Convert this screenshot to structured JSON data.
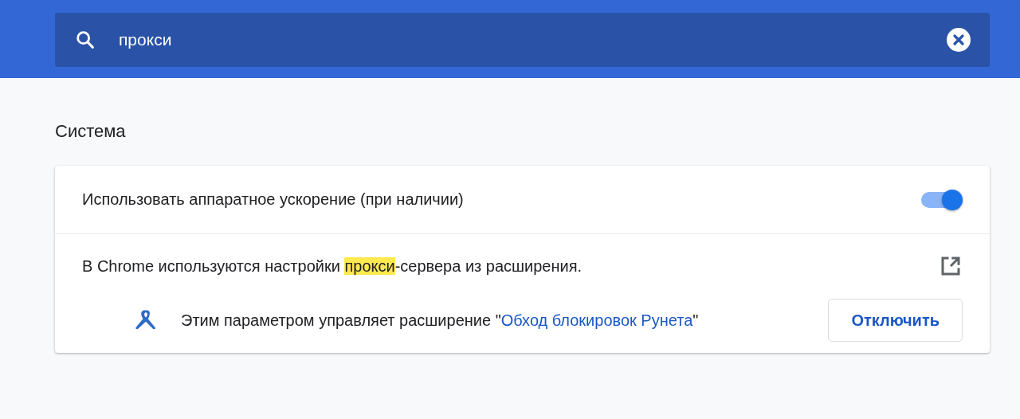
{
  "search": {
    "value": "прокси"
  },
  "section": {
    "title": "Система"
  },
  "settings": [
    {
      "kind": "toggle",
      "label": "Использовать аппаратное ускорение (при наличии)",
      "on": true
    },
    {
      "kind": "proxy",
      "before": "В Chrome используются настройки ",
      "highlight": "прокси",
      "after": "-сервера из расширения.",
      "note": "Этим параметром управляет расширение \"",
      "link": "Обход блокировок Рунета",
      "note_end": "\"",
      "button": "Отключить"
    }
  ]
}
